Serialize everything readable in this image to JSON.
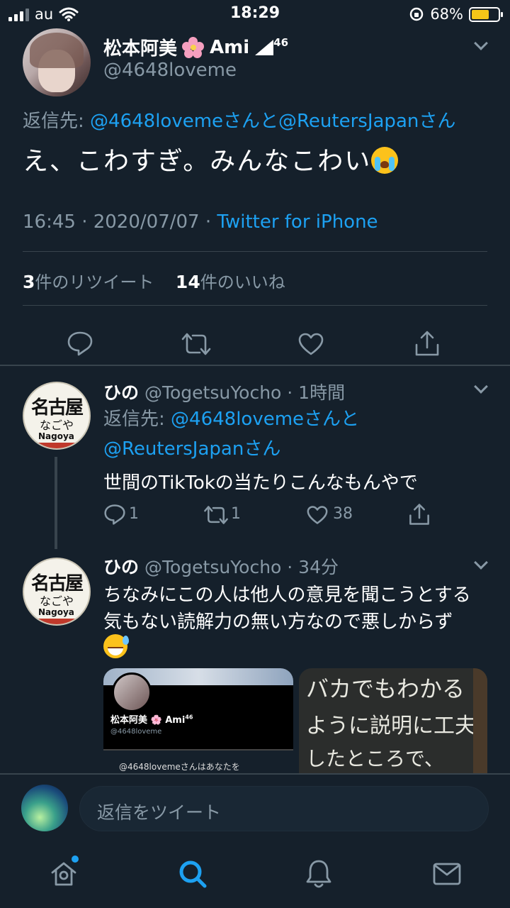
{
  "status_bar": {
    "carrier": "au",
    "time": "18:29",
    "battery": "68%",
    "battery_level": 0.68
  },
  "main_tweet": {
    "display_name": "松本阿美",
    "name_suffix": "Ami",
    "superscript": "46",
    "handle": "@4648loveme",
    "reply_prefix": "返信先: ",
    "reply_users": "@4648lovemeさんと@ReutersJapanさん",
    "text": "え、こわすぎ。みんなこわい",
    "timestamp": "16:45 · 2020/07/07 · ",
    "source": "Twitter for iPhone",
    "retweets_count": "3",
    "retweets_label": "件のリツイート",
    "likes_count": "14",
    "likes_label": "件のいいね"
  },
  "replies": [
    {
      "display_name": "ひの",
      "handle_time": "@TogetsuYocho · 1時間",
      "reply_prefix": "返信先: ",
      "reply_users_1": "@4648lovemeさんと",
      "reply_users_2": "@ReutersJapanさん",
      "text": "世間のTikTokの当たりこんなもんやで",
      "reply_count": "1",
      "retweet_count": "1",
      "like_count": "38"
    },
    {
      "display_name": "ひの",
      "handle_time": "@TogetsuYocho · 34分",
      "text_line1": "ちなみにこの人は他人の意見を聞こうとする",
      "text_line2": "気もない読解力の無い方なので悪しからず"
    }
  ],
  "media": {
    "card_name": "松本阿美 🌸 Ami",
    "card_superscript": "46",
    "card_handle": "@4648loveme",
    "card_text": "@4648lovemeさんはあなたを",
    "chalk_line1": "バカでもわかる",
    "chalk_line2": "ように説明に工夫",
    "chalk_line3": "したところで、"
  },
  "composer": {
    "placeholder": "返信をツイート"
  },
  "icons": {
    "reply": "reply-icon",
    "retweet": "retweet-icon",
    "like": "heart-icon",
    "share": "share-icon",
    "home": "home-icon",
    "search": "search-icon",
    "notifications": "bell-icon",
    "messages": "mail-icon"
  },
  "colors": {
    "background": "#15202b",
    "link": "#1da1f2",
    "muted": "#8899a6",
    "divider": "#38444d"
  }
}
